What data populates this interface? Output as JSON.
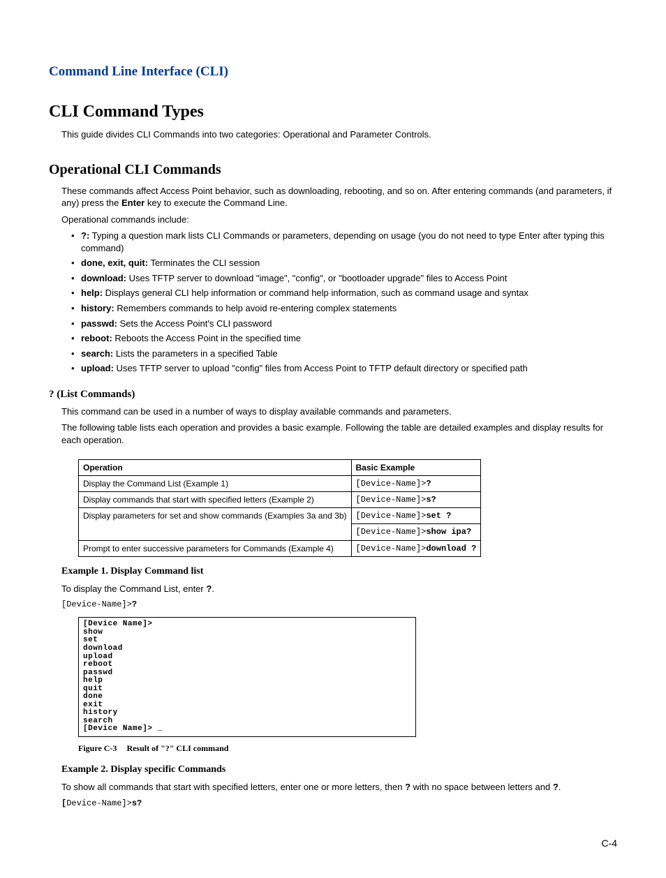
{
  "chapter_title": "Command Line Interface (CLI)",
  "section_title": "CLI Command Types",
  "intro": "This guide divides CLI Commands into two categories: Operational and Parameter Controls.",
  "operational": {
    "heading": "Operational CLI Commands",
    "para1_a": "These commands affect Access Point behavior, such as downloading, rebooting, and so on. After entering commands (and parameters, if any) press the ",
    "enter_key": "Enter",
    "para1_b": " key to execute the Command Line.",
    "para2": "Operational commands include:",
    "items": [
      {
        "name": "?:",
        "desc": " Typing a question mark lists CLI Commands or parameters, depending on usage (you do not need to type Enter after typing this command)"
      },
      {
        "name": "done, exit, quit:",
        "desc": " Terminates the CLI session"
      },
      {
        "name": "download:",
        "desc": " Uses TFTP server to download \"image\", \"config\", or \"bootloader upgrade\" files to Access Point"
      },
      {
        "name": "help:",
        "desc": " Displays general CLI help information or command help information, such as command usage and syntax"
      },
      {
        "name": "history:",
        "desc": " Remembers commands to help avoid re-entering complex statements"
      },
      {
        "name": "passwd:",
        "desc": " Sets the Access Point's CLI password"
      },
      {
        "name": "reboot:",
        "desc": " Reboots the Access Point in the specified time"
      },
      {
        "name": "search:",
        "desc": " Lists the parameters in a specified Table"
      },
      {
        "name": "upload:",
        "desc": " Uses TFTP server to upload \"config\" files from Access Point to TFTP default directory or specified path"
      }
    ]
  },
  "list_commands": {
    "heading": "? (List Commands)",
    "para1": "This command can be used in a number of ways to display available commands and parameters.",
    "para2": "The following table lists each operation and provides a basic example. Following the table are detailed examples and display results for each operation."
  },
  "table": {
    "headers": {
      "op": "Operation",
      "ex": "Basic Example"
    },
    "rows": [
      {
        "op": "Display the Command List (Example 1)",
        "prefix": "[Device-Name]>",
        "cmd": "?"
      },
      {
        "op": "Display commands that start with specified letters (Example 2)",
        "prefix": "[Device-Name]>",
        "cmd": "s?"
      },
      {
        "op": "Display parameters for set and show commands (Examples 3a and 3b)",
        "prefix": "[Device-Name]>",
        "cmd": "set ?",
        "prefix2": "[Device-Name]>",
        "cmd2": "show ipa?"
      },
      {
        "op": "Prompt to enter successive parameters for Commands (Example 4)",
        "prefix": "[Device-Name]>",
        "cmd": "download ?"
      }
    ]
  },
  "example1": {
    "heading": "Example 1. Display Command list",
    "text_a": "To display the Command List, enter ",
    "q": "?",
    "text_b": ".",
    "code_prefix": "[Device-Name]>",
    "code_cmd": "?",
    "terminal": "[Device Name]>\nshow\nset\ndownload\nupload\nreboot\npasswd\nhelp\nquit\ndone\nexit\nhistory\nsearch\n[Device Name]> _",
    "figure_label": "Figure C-3",
    "figure_title": "Result of \"?\" CLI command"
  },
  "example2": {
    "heading": "Example 2. Display specific Commands",
    "text_a": "To show all commands that start with specified letters, enter one or more letters, then ",
    "q": "?",
    "text_b": " with no space between letters and ",
    "q2": "?",
    "text_c": ".",
    "code_prefix_open": "[",
    "code_prefix_rest": "Device-Name]>",
    "code_cmd": "s?"
  },
  "page_number": "C-4"
}
